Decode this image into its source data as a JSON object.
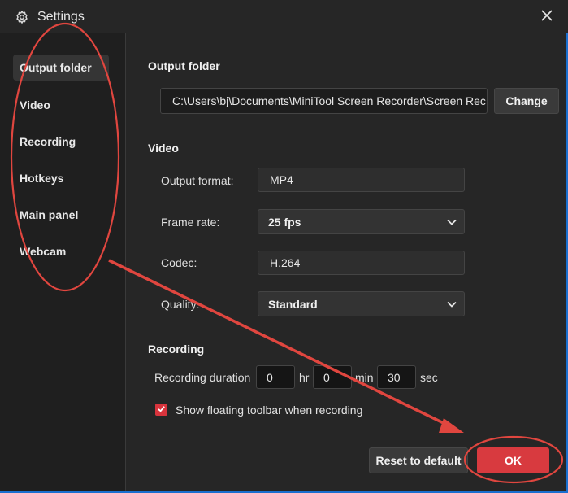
{
  "window": {
    "title": "Settings"
  },
  "sidebar": {
    "items": [
      {
        "label": "Output folder",
        "active": true
      },
      {
        "label": "Video"
      },
      {
        "label": "Recording"
      },
      {
        "label": "Hotkeys"
      },
      {
        "label": "Main panel"
      },
      {
        "label": "Webcam"
      }
    ]
  },
  "output_folder": {
    "title": "Output folder",
    "path": "C:\\Users\\bj\\Documents\\MiniTool Screen Recorder\\Screen Rec",
    "change_label": "Change"
  },
  "video": {
    "title": "Video",
    "output_format_label": "Output format:",
    "output_format_value": "MP4",
    "frame_rate_label": "Frame rate:",
    "frame_rate_value": "25 fps",
    "codec_label": "Codec:",
    "codec_value": "H.264",
    "quality_label": "Quality:",
    "quality_value": "Standard"
  },
  "recording": {
    "title": "Recording",
    "duration_label": "Recording duration",
    "hours": "0",
    "hours_unit": "hr",
    "minutes": "0",
    "minutes_unit": "min",
    "seconds": "30",
    "seconds_unit": "sec",
    "floating_toolbar_label": "Show floating toolbar when recording",
    "floating_toolbar_checked": true
  },
  "footer": {
    "reset_label": "Reset to default",
    "ok_label": "OK"
  },
  "colors": {
    "accent": "#d83a3f",
    "annotation": "#e0463f"
  }
}
